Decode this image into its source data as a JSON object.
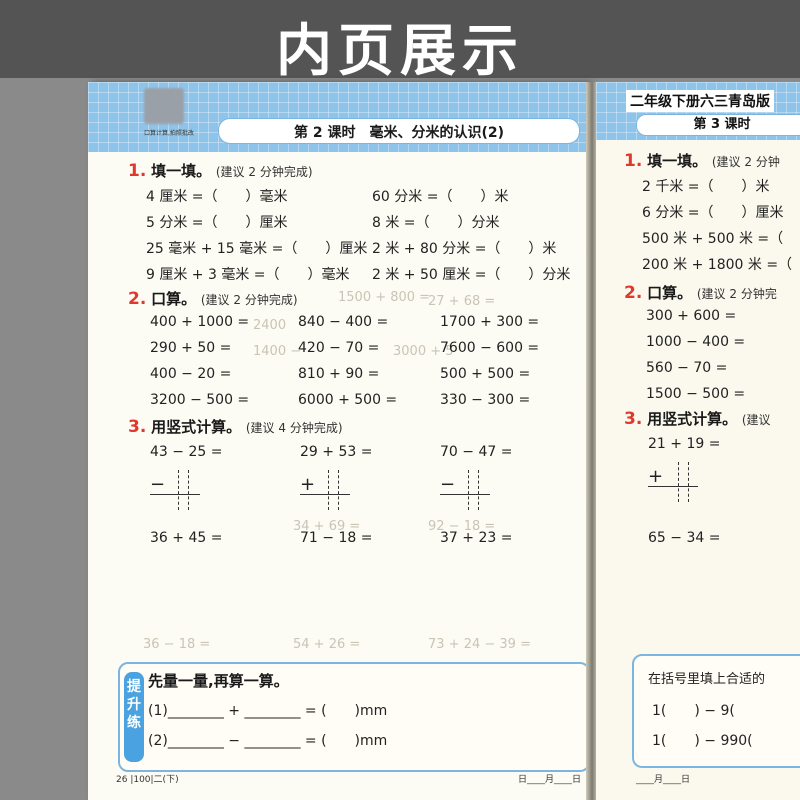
{
  "banner": {
    "title": "内页展示"
  },
  "left": {
    "qr_caption": "口算计算,拍照批改",
    "lesson_title": "第 2 课时　毫米、分米的认识(2)",
    "s1": {
      "num": "1.",
      "title": "填一填。",
      "hint": "(建议 2 分钟完成)",
      "rows": [
        [
          "4 厘米 =（　　）毫米",
          "60 分米 =（　　）米"
        ],
        [
          "5 分米 =（　　）厘米",
          "8 米 =（　　）分米"
        ],
        [
          "25 毫米 + 15 毫米 =（　　）厘米",
          "2 米 + 80 分米 =（　　）米"
        ],
        [
          "9 厘米 + 3 毫米 =（　　）毫米",
          "2 米 + 50 厘米 =（　　）分米"
        ]
      ]
    },
    "s2": {
      "num": "2.",
      "title": "口算。",
      "hint": "(建议 2 分钟完成)",
      "rows": [
        [
          "400 + 1000 =",
          "840 − 400 =",
          "1700 + 300 ="
        ],
        [
          "290 + 50 =",
          "420 − 70 =",
          "7600 − 600 ="
        ],
        [
          "400 − 20 =",
          "810 + 90 =",
          "500 + 500 ="
        ],
        [
          "3200 − 500 =",
          "6000 + 500 =",
          "330 − 300 ="
        ]
      ]
    },
    "s3": {
      "num": "3.",
      "title": "用竖式计算。",
      "hint": "(建议 4 分钟完成)",
      "row1": [
        "43 − 25 =",
        "29 + 53 =",
        "70 − 47 ="
      ],
      "ops1": [
        "−",
        "+",
        "−"
      ],
      "row2": [
        "36 + 45 =",
        "71 − 18 =",
        "37 + 23 ="
      ]
    },
    "ghosts": [
      "1500 + 800 =",
      "27 + 68 =",
      "2400",
      "3000 + 5",
      "1400 −",
      "34 + 69 =",
      "92 − 18 =",
      "36 − 18 =",
      "54 + 26 =",
      "73 + 24 − 39 ="
    ],
    "bottom": {
      "label": "提升练",
      "title": "先量一量,再算一算。",
      "line1": "(1)________ + ________ = (　　)mm",
      "line2": "(2)________ − ________ = (　　)mm"
    },
    "footer_left": "26 |100|二(下)",
    "footer_right": "日____月____日"
  },
  "right": {
    "header": "二年级下册六三青岛版",
    "lesson": "第 3 课时",
    "s1": {
      "num": "1.",
      "title": "填一填。",
      "hint": "(建议 2 分钟",
      "rows": [
        "2 千米 =（　　）米",
        "6 分米 =（　　）厘米",
        "500 米 + 500 米 =（",
        "200 米 + 1800 米 =（"
      ]
    },
    "s2": {
      "num": "2.",
      "title": "口算。",
      "hint": "(建议 2 分钟完",
      "rows": [
        "300 + 600 =",
        "1000 − 400 =",
        "560 − 70 =",
        "1500 − 500 ="
      ]
    },
    "s3": {
      "num": "3.",
      "title": "用竖式计算。",
      "hint": "(建议",
      "row1": "21 + 19 =",
      "op": "+",
      "row2": "65 − 34 ="
    },
    "box_title": "在括号里填上合适的",
    "box_line1": "1(　　) − 9(",
    "box_line2": "1(　　) − 990(",
    "footer": "____月____日"
  }
}
